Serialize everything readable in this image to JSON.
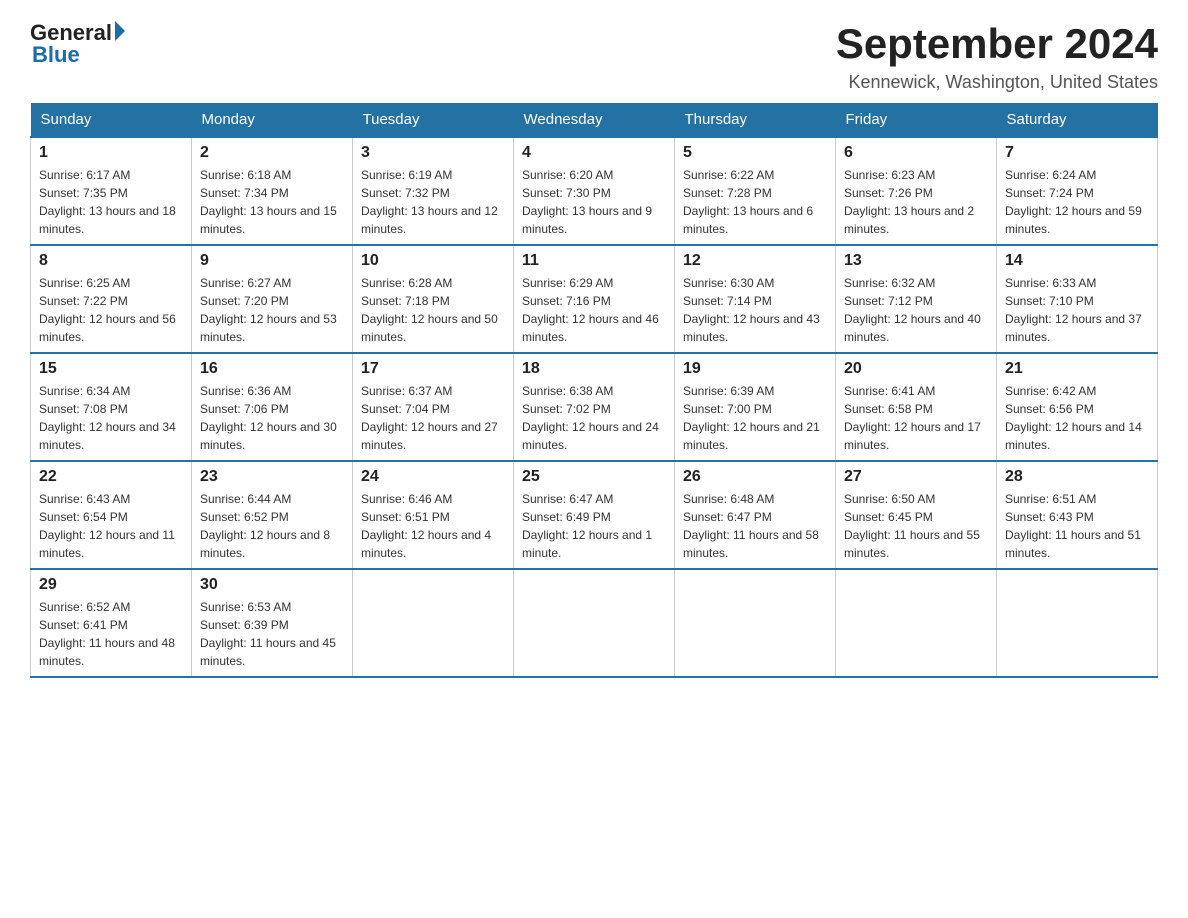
{
  "logo": {
    "general": "General",
    "blue": "Blue"
  },
  "title": "September 2024",
  "location": "Kennewick, Washington, United States",
  "days_of_week": [
    "Sunday",
    "Monday",
    "Tuesday",
    "Wednesday",
    "Thursday",
    "Friday",
    "Saturday"
  ],
  "weeks": [
    [
      {
        "day": "1",
        "sunrise": "6:17 AM",
        "sunset": "7:35 PM",
        "daylight": "13 hours and 18 minutes."
      },
      {
        "day": "2",
        "sunrise": "6:18 AM",
        "sunset": "7:34 PM",
        "daylight": "13 hours and 15 minutes."
      },
      {
        "day": "3",
        "sunrise": "6:19 AM",
        "sunset": "7:32 PM",
        "daylight": "13 hours and 12 minutes."
      },
      {
        "day": "4",
        "sunrise": "6:20 AM",
        "sunset": "7:30 PM",
        "daylight": "13 hours and 9 minutes."
      },
      {
        "day": "5",
        "sunrise": "6:22 AM",
        "sunset": "7:28 PM",
        "daylight": "13 hours and 6 minutes."
      },
      {
        "day": "6",
        "sunrise": "6:23 AM",
        "sunset": "7:26 PM",
        "daylight": "13 hours and 2 minutes."
      },
      {
        "day": "7",
        "sunrise": "6:24 AM",
        "sunset": "7:24 PM",
        "daylight": "12 hours and 59 minutes."
      }
    ],
    [
      {
        "day": "8",
        "sunrise": "6:25 AM",
        "sunset": "7:22 PM",
        "daylight": "12 hours and 56 minutes."
      },
      {
        "day": "9",
        "sunrise": "6:27 AM",
        "sunset": "7:20 PM",
        "daylight": "12 hours and 53 minutes."
      },
      {
        "day": "10",
        "sunrise": "6:28 AM",
        "sunset": "7:18 PM",
        "daylight": "12 hours and 50 minutes."
      },
      {
        "day": "11",
        "sunrise": "6:29 AM",
        "sunset": "7:16 PM",
        "daylight": "12 hours and 46 minutes."
      },
      {
        "day": "12",
        "sunrise": "6:30 AM",
        "sunset": "7:14 PM",
        "daylight": "12 hours and 43 minutes."
      },
      {
        "day": "13",
        "sunrise": "6:32 AM",
        "sunset": "7:12 PM",
        "daylight": "12 hours and 40 minutes."
      },
      {
        "day": "14",
        "sunrise": "6:33 AM",
        "sunset": "7:10 PM",
        "daylight": "12 hours and 37 minutes."
      }
    ],
    [
      {
        "day": "15",
        "sunrise": "6:34 AM",
        "sunset": "7:08 PM",
        "daylight": "12 hours and 34 minutes."
      },
      {
        "day": "16",
        "sunrise": "6:36 AM",
        "sunset": "7:06 PM",
        "daylight": "12 hours and 30 minutes."
      },
      {
        "day": "17",
        "sunrise": "6:37 AM",
        "sunset": "7:04 PM",
        "daylight": "12 hours and 27 minutes."
      },
      {
        "day": "18",
        "sunrise": "6:38 AM",
        "sunset": "7:02 PM",
        "daylight": "12 hours and 24 minutes."
      },
      {
        "day": "19",
        "sunrise": "6:39 AM",
        "sunset": "7:00 PM",
        "daylight": "12 hours and 21 minutes."
      },
      {
        "day": "20",
        "sunrise": "6:41 AM",
        "sunset": "6:58 PM",
        "daylight": "12 hours and 17 minutes."
      },
      {
        "day": "21",
        "sunrise": "6:42 AM",
        "sunset": "6:56 PM",
        "daylight": "12 hours and 14 minutes."
      }
    ],
    [
      {
        "day": "22",
        "sunrise": "6:43 AM",
        "sunset": "6:54 PM",
        "daylight": "12 hours and 11 minutes."
      },
      {
        "day": "23",
        "sunrise": "6:44 AM",
        "sunset": "6:52 PM",
        "daylight": "12 hours and 8 minutes."
      },
      {
        "day": "24",
        "sunrise": "6:46 AM",
        "sunset": "6:51 PM",
        "daylight": "12 hours and 4 minutes."
      },
      {
        "day": "25",
        "sunrise": "6:47 AM",
        "sunset": "6:49 PM",
        "daylight": "12 hours and 1 minute."
      },
      {
        "day": "26",
        "sunrise": "6:48 AM",
        "sunset": "6:47 PM",
        "daylight": "11 hours and 58 minutes."
      },
      {
        "day": "27",
        "sunrise": "6:50 AM",
        "sunset": "6:45 PM",
        "daylight": "11 hours and 55 minutes."
      },
      {
        "day": "28",
        "sunrise": "6:51 AM",
        "sunset": "6:43 PM",
        "daylight": "11 hours and 51 minutes."
      }
    ],
    [
      {
        "day": "29",
        "sunrise": "6:52 AM",
        "sunset": "6:41 PM",
        "daylight": "11 hours and 48 minutes."
      },
      {
        "day": "30",
        "sunrise": "6:53 AM",
        "sunset": "6:39 PM",
        "daylight": "11 hours and 45 minutes."
      },
      null,
      null,
      null,
      null,
      null
    ]
  ],
  "labels": {
    "sunrise": "Sunrise:",
    "sunset": "Sunset:",
    "daylight": "Daylight:"
  }
}
